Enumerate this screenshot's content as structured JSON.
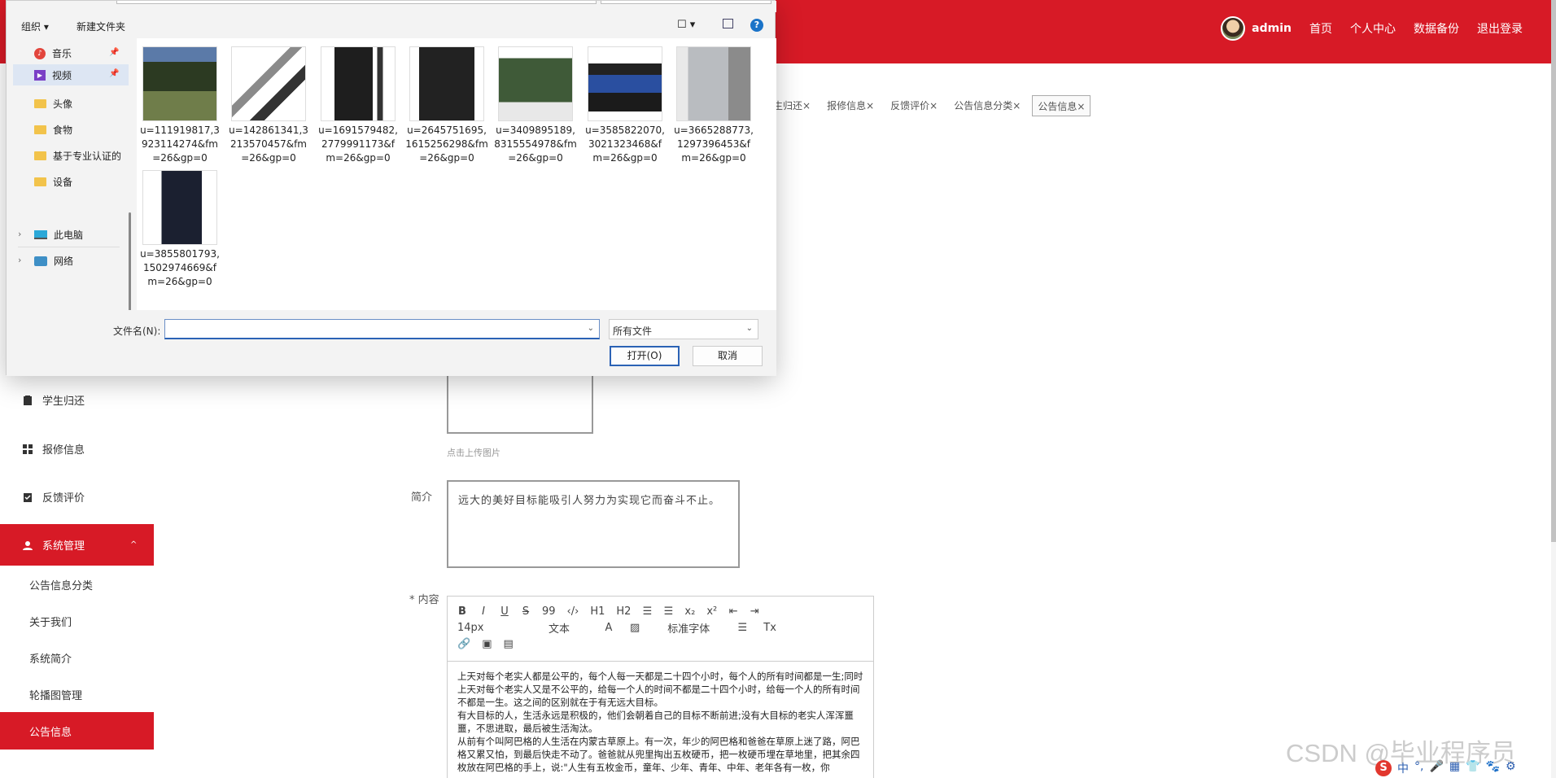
{
  "header": {
    "username": "admin",
    "nav": [
      "首页",
      "个人中心",
      "数据备份",
      "退出登录"
    ]
  },
  "tabs": [
    "生归还",
    "报修信息",
    "反馈评价",
    "公告信息分类",
    "公告信息"
  ],
  "tab_close": "×",
  "sidebar": {
    "items": [
      "学生归还",
      "报修信息",
      "反馈评价"
    ],
    "system_menu": "系统管理",
    "system_caret": "^",
    "sub_items": [
      "公告信息分类",
      "关于我们",
      "系统简介",
      "轮播图管理",
      "公告信息"
    ]
  },
  "form": {
    "upload_hint": "点击上传图片",
    "intro_label": "简介",
    "intro_value": "远大的美好目标能吸引人努力为实现它而奋斗不止。",
    "content_label": "* 内容",
    "editor": {
      "row1": [
        "B",
        "I",
        "U",
        "S",
        "99",
        "‹/›",
        "H1",
        "H2",
        "☰",
        "☰",
        "x₂",
        "x²",
        "⇤",
        "⇥"
      ],
      "font_size": "14px",
      "block": "文本",
      "font_family": "标准字体",
      "content": [
        "上天对每个老实人都是公平的，每个人每一天都是二十四个小时，每个人的所有时间都是一生;同时上天对每个老实人又是不公平的，给每一个人的时间不都是二十四个小时，给每一个人的所有时间不都是一生。这之间的区别就在于有无远大目标。",
        "有大目标的人，生活永远是积极的，他们会朝着自己的目标不断前进;没有大目标的老实人浑浑噩噩，不思进取，最后被生活淘汰。",
        "从前有个叫阿巴格的人生活在内蒙古草原上。有一次，年少的阿巴格和爸爸在草原上迷了路，阿巴格又累又怕，到最后快走不动了。爸爸就从兜里掏出五枚硬币，把一枚硬币埋在草地里，把其余四枚放在阿巴格的手上，说:\"人生有五枚金币，童年、少年、青年、中年、老年各有一枚，你"
      ]
    }
  },
  "watermark": "CSDN @毕业程序员",
  "ime": [
    "S",
    "中",
    "°,",
    "🎤",
    "▦",
    "👕",
    "🐾",
    "⚙"
  ],
  "dialog": {
    "toolbar": {
      "organize": "组织 ▾",
      "new_folder": "新建文件夹",
      "view": "☐ ▾",
      "help": "?"
    },
    "nav": [
      {
        "label": "音乐",
        "icon": "music-icon"
      },
      {
        "label": "视频",
        "icon": "video-icon"
      },
      {
        "label": "头像",
        "icon": "folder-icon"
      },
      {
        "label": "食物",
        "icon": "folder-icon"
      },
      {
        "label": "基于专业认证的",
        "icon": "folder-icon"
      },
      {
        "label": "设备",
        "icon": "folder-icon"
      },
      {
        "label": "此电脑",
        "icon": "computer-icon"
      },
      {
        "label": "网络",
        "icon": "network-icon"
      }
    ],
    "files": [
      "u=111919817,3\n923114274&fm\n=26&gp=0",
      "u=142861341,3\n213570457&fm\n=26&gp=0",
      "u=1691579482,\n2779991173&f\nm=26&gp=0",
      "u=2645751695,\n1615256298&fm\n=26&gp=0",
      "u=3409895189,\n8315554978&fm\n=26&gp=0",
      "u=3585822070,\n3021323468&f\nm=26&gp=0",
      "u=3665288773,\n1297396453&f\nm=26&gp=0",
      "u=3855801793,\n1502974669&f\nm=26&gp=0"
    ],
    "filename_label": "文件名(N):",
    "filename_value": "",
    "filetype": "所有文件",
    "open_button": "打开(O)",
    "cancel_button": "取消",
    "dropdown": "⌄"
  }
}
